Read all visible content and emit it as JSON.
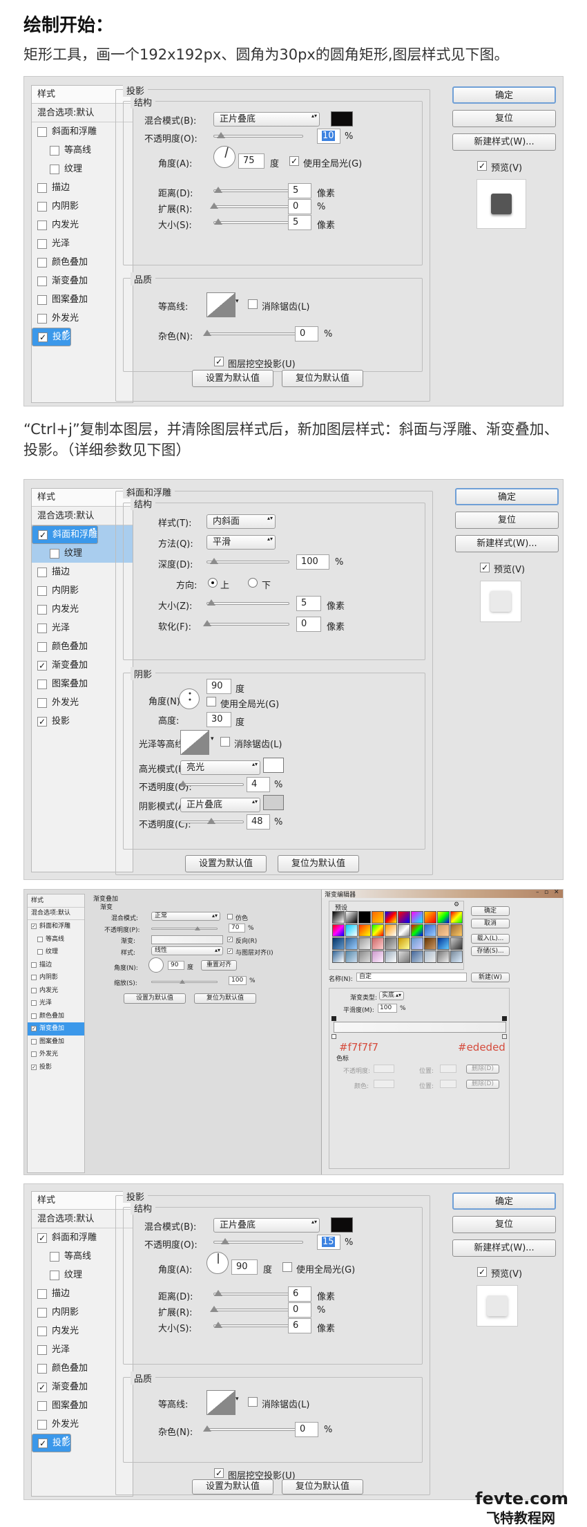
{
  "heading": "绘制开始：",
  "intro": "矩形工具，画一个192x192px、圆角为30px的圆角矩形,图层样式见下图。",
  "mid_text": "“Ctrl+j”复制本图层，并清除图层样式后，新加图层样式：斜面与浮雕、渐变叠加、投影。（详细参数见下图）",
  "sidebar": {
    "header": "样式",
    "blend": "混合选项:默认",
    "items": [
      "斜面和浮雕",
      "等高线",
      "纹理",
      "描边",
      "内阴影",
      "内发光",
      "光泽",
      "颜色叠加",
      "渐变叠加",
      "图案叠加",
      "外发光",
      "投影"
    ]
  },
  "buttons": {
    "ok": "确定",
    "reset": "复位",
    "new_style": "新建样式(W)...",
    "preview": "预览(V)",
    "set_default": "设置为默认值",
    "reset_default": "复位为默认值"
  },
  "shadow1": {
    "title": "投影",
    "struct": "结构",
    "blend_label": "混合模式(B):",
    "blend_value": "正片叠底",
    "opacity_label": "不透明度(O):",
    "opacity": "10",
    "pct": "%",
    "angle_label": "角度(A):",
    "angle": "75",
    "deg": "度",
    "global_light": "使用全局光(G)",
    "distance_label": "距离(D):",
    "distance": "5",
    "px": "像素",
    "spread_label": "扩展(R):",
    "spread": "0",
    "size_label": "大小(S):",
    "size": "5",
    "quality": "品质",
    "contour_label": "等高线:",
    "anti_alias": "消除锯齿(L)",
    "noise_label": "杂色(N):",
    "noise": "0",
    "knockout": "图层挖空投影(U)",
    "shadow_color": "#0c0a0a"
  },
  "bevel": {
    "title": "斜面和浮雕",
    "struct": "结构",
    "style_label": "样式(T):",
    "style": "内斜面",
    "technique_label": "方法(Q):",
    "technique": "平滑",
    "depth_label": "深度(D):",
    "depth": "100",
    "direction_label": "方向:",
    "up": "上",
    "down": "下",
    "size_label": "大小(Z):",
    "size": "5",
    "soften_label": "软化(F):",
    "soften": "0",
    "shading": "阴影",
    "angle_label": "角度(N):",
    "angle": "90",
    "global_light": "使用全局光(G)",
    "altitude_label": "高度:",
    "altitude": "30",
    "gloss_label": "光泽等高线:",
    "anti_alias": "消除锯齿(L)",
    "highlight_label": "高光模式(H):",
    "highlight_mode": "亮光",
    "hl_opacity": "4",
    "shadow_mode_label": "阴影模式(A):",
    "shadow_mode": "正片叠底",
    "sh_opacity": "48",
    "opacity_label": "不透明度(O):",
    "opacity2_label": "不透明度(C):"
  },
  "gradient": {
    "title": "渐变叠加",
    "sub": "渐变",
    "blend_label": "混合模式:",
    "blend": "正常",
    "dither": "仿色",
    "opacity_label": "不透明度(P):",
    "opacity": "70",
    "grad_label": "渐变:",
    "reverse": "反向(R)",
    "style_label": "样式:",
    "style": "线性",
    "align": "与图层对齐(I)",
    "angle_label": "角度(N):",
    "angle": "90",
    "reset_align": "重置对齐",
    "scale_label": "缩放(S):",
    "scale": "100"
  },
  "editor": {
    "title": "渐变编辑器",
    "presets": "预设",
    "ok": "确定",
    "cancel": "取消",
    "load": "载入(L)...",
    "save": "存储(S)...",
    "name_label": "名称(N):",
    "name": "自定",
    "new": "新建(W)",
    "type_label": "渐变类型:",
    "type": "实底",
    "smooth_label": "平滑度(M):",
    "smooth": "100",
    "stop_left": "#f7f7f7",
    "stop_right": "#ededed",
    "stops": "色标",
    "opacity_label": "不透明度:",
    "location_label": "位置:",
    "delete": "删除(D)",
    "color_label": "颜色:"
  },
  "shadow2": {
    "opacity": "15",
    "angle": "90",
    "distance": "6",
    "spread": "0",
    "size": "6",
    "noise": "0"
  },
  "watermark": {
    "top": "fevte.com",
    "bottom": "飞特教程网"
  }
}
